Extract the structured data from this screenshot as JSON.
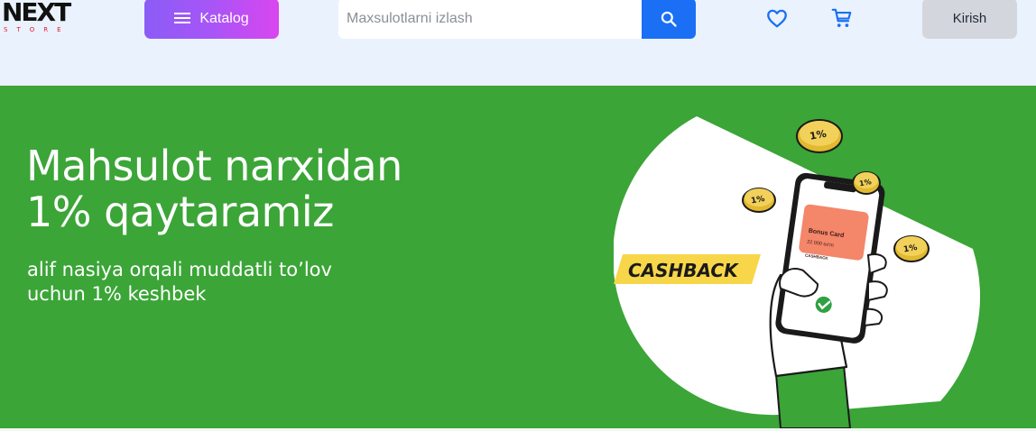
{
  "header": {
    "logo_text": "NEXT",
    "logo_sub": "STORE",
    "catalog_label": "Katalog",
    "search_placeholder": "Maxsulotlarni izlash",
    "search_value": "",
    "login_label": "Kirish",
    "icons": [
      "menu-icon",
      "search-icon",
      "heart-icon",
      "cart-icon"
    ]
  },
  "banner": {
    "headline_line1": "Mahsulot narxidan",
    "headline_line2": "1% qaytaramiz",
    "subtitle_line1": "alif nasiya orqali muddatli to’lov",
    "subtitle_line2": "uchun 1% keshbek",
    "cashback_label": "CASHBACK",
    "coin_label": "1%",
    "card_title": "Bonus Card",
    "card_amount": "22 000 so'm",
    "card_caption": "CASHBACK"
  },
  "colors": {
    "accent_blue": "#1a6ff5",
    "banner_green": "#3ba537",
    "catalog_gradient_start": "#8b5cf6",
    "catalog_gradient_end": "#d946ef",
    "cashback_yellow": "#f7d64a"
  }
}
